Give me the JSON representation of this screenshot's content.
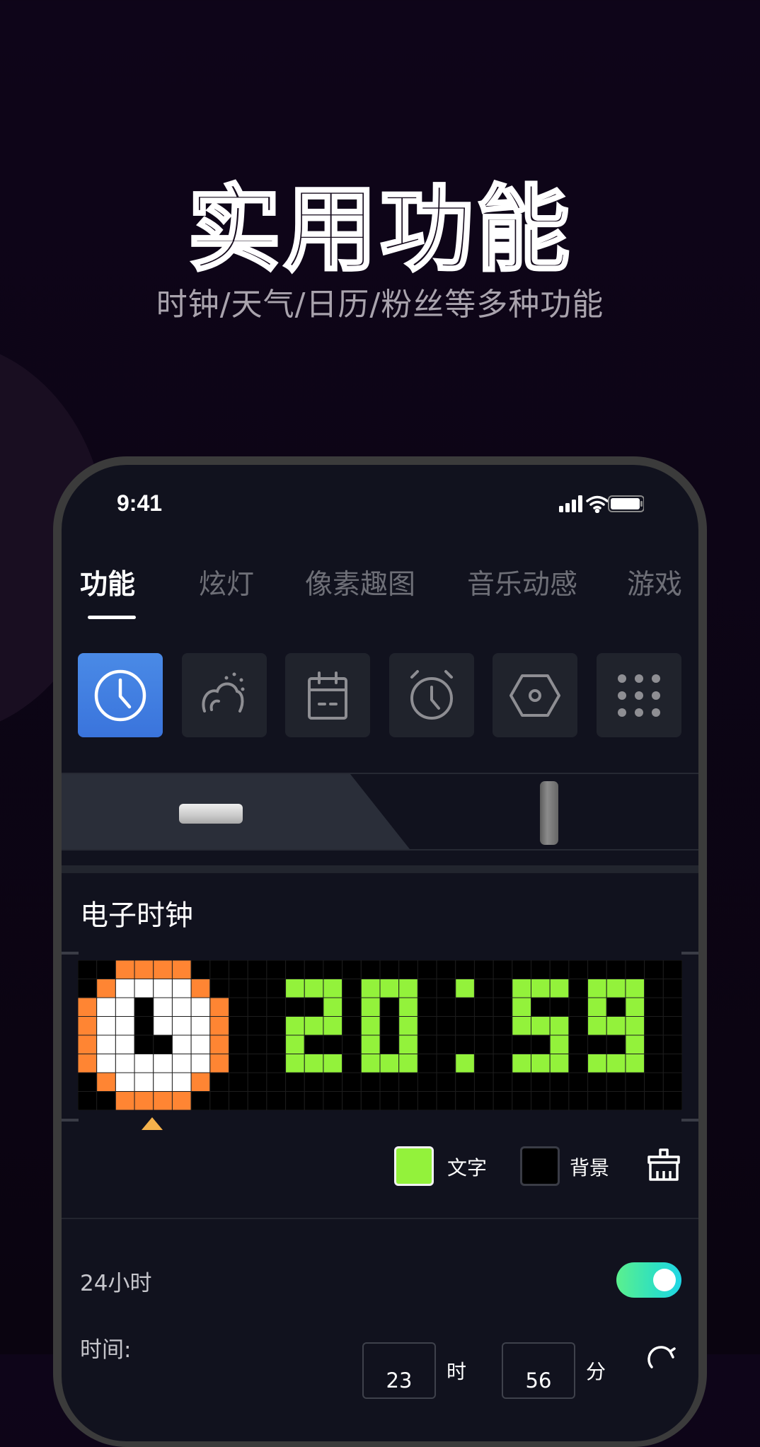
{
  "hero": {
    "title": "实用功能",
    "subtitle": "时钟/天气/日历/粉丝等多种功能"
  },
  "status_bar": {
    "time": "9:41",
    "icons": [
      "cellular-signal-icon",
      "wifi-icon",
      "battery-icon"
    ]
  },
  "tabs": [
    {
      "label": "功能",
      "active": true
    },
    {
      "label": "炫灯",
      "active": false
    },
    {
      "label": "像素趣图",
      "active": false
    },
    {
      "label": "音乐动感",
      "active": false
    },
    {
      "label": "游戏",
      "active": false
    }
  ],
  "feature_tiles": [
    {
      "icon": "clock-icon",
      "active": true
    },
    {
      "icon": "weather-icon",
      "active": false
    },
    {
      "icon": "calendar-icon",
      "active": false
    },
    {
      "icon": "alarm-clock-icon",
      "active": false
    },
    {
      "icon": "hexagon-icon",
      "active": false
    },
    {
      "icon": "more-grid-icon",
      "active": false
    }
  ],
  "devices": [
    {
      "orientation": "horizontal",
      "selected": true
    },
    {
      "orientation": "vertical",
      "selected": false
    }
  ],
  "clock_section": {
    "title": "电子时钟",
    "display_time": "20:59",
    "text_color": "#93F23B",
    "background_color": "#000000",
    "clock_icon_colors": {
      "ring": "#FF8533",
      "face": "#FFFFFF",
      "hands": "#000000"
    },
    "pointer_color": "#F5B24C",
    "text_color_label": "文字",
    "background_color_label": "背景"
  },
  "settings": {
    "hour24_label": "24小时",
    "hour24_enabled": true,
    "time_label": "时间:",
    "hour_value": "23",
    "hour_unit": "时",
    "minute_value": "56",
    "minute_unit": "分"
  },
  "colors": {
    "accent_blue": "#3F7FE2",
    "toggle_start": "#5BF08E",
    "toggle_end": "#1FD6E6"
  }
}
